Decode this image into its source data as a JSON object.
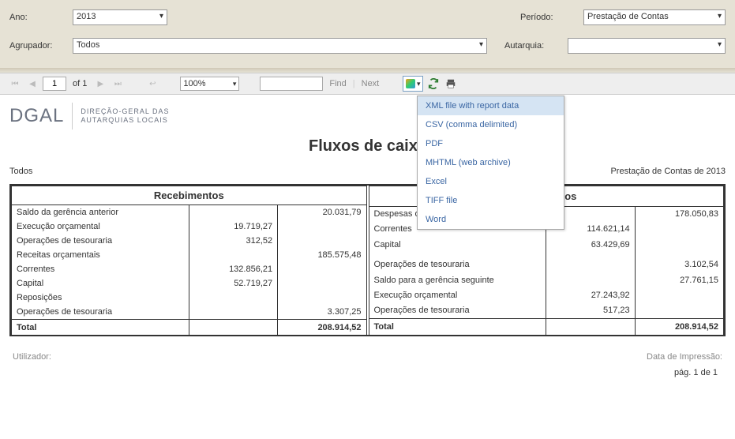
{
  "filters": {
    "ano_label": "Ano:",
    "ano_value": "2013",
    "agrupador_label": "Agrupador:",
    "agrupador_value": "Todos",
    "periodo_label": "Período:",
    "periodo_value": "Prestação de Contas",
    "autarquia_label": "Autarquia:",
    "autarquia_value": ""
  },
  "toolbar": {
    "page_value": "1",
    "of_text": "of 1",
    "zoom": "100%",
    "find": "Find",
    "next": "Next"
  },
  "export_menu": {
    "items": [
      "XML file with report data",
      "CSV (comma delimited)",
      "PDF",
      "MHTML (web archive)",
      "Excel",
      "TIFF file",
      "Word"
    ]
  },
  "logo": {
    "main": "DGAL",
    "sub1": "DIREÇÃO-GERAL DAS",
    "sub2": "AUTARQUIAS LOCAIS"
  },
  "report": {
    "title": "Fluxos de caixa",
    "meta_left": "Todos",
    "meta_right": "Prestação de Contas de 2013"
  },
  "recebimentos": {
    "header": "Recebimentos",
    "rows": [
      {
        "label": "Saldo da gerência anterior",
        "v1": "",
        "v2": "20.031,79"
      },
      {
        "label": "Execução orçamental",
        "v1": "19.719,27",
        "v2": ""
      },
      {
        "label": "Operações de tesouraria",
        "v1": "312,52",
        "v2": ""
      },
      {
        "label": "Receitas orçamentais",
        "v1": "",
        "v2": "185.575,48"
      },
      {
        "label": "Correntes",
        "v1": "132.856,21",
        "v2": ""
      },
      {
        "label": "Capital",
        "v1": "52.719,27",
        "v2": ""
      },
      {
        "label": "Reposições",
        "v1": "",
        "v2": ""
      },
      {
        "label": "Operações de tesouraria",
        "v1": "",
        "v2": "3.307,25"
      }
    ],
    "total_label": "Total",
    "total_value": "208.914,52"
  },
  "pagamentos": {
    "header": "Pagamentos",
    "rows": [
      {
        "label": "Despesas orçamentais",
        "v1": "",
        "v2": "178.050,83"
      },
      {
        "label": "Correntes",
        "v1": "114.621,14",
        "v2": ""
      },
      {
        "label": "Capital",
        "v1": "63.429,69",
        "v2": ""
      },
      {
        "label": "",
        "v1": "",
        "v2": ""
      },
      {
        "label": "Operações de tesouraria",
        "v1": "",
        "v2": "3.102,54"
      },
      {
        "label": "Saldo para a gerência seguinte",
        "v1": "",
        "v2": "27.761,15"
      },
      {
        "label": "Execução orçamental",
        "v1": "27.243,92",
        "v2": ""
      },
      {
        "label": "Operações de tesouraria",
        "v1": "517,23",
        "v2": ""
      }
    ],
    "total_label": "Total",
    "total_value": "208.914,52"
  },
  "footer": {
    "utilizador": "Utilizador:",
    "data_impressao": "Data de Impressão:",
    "page": "pág. 1 de 1"
  }
}
